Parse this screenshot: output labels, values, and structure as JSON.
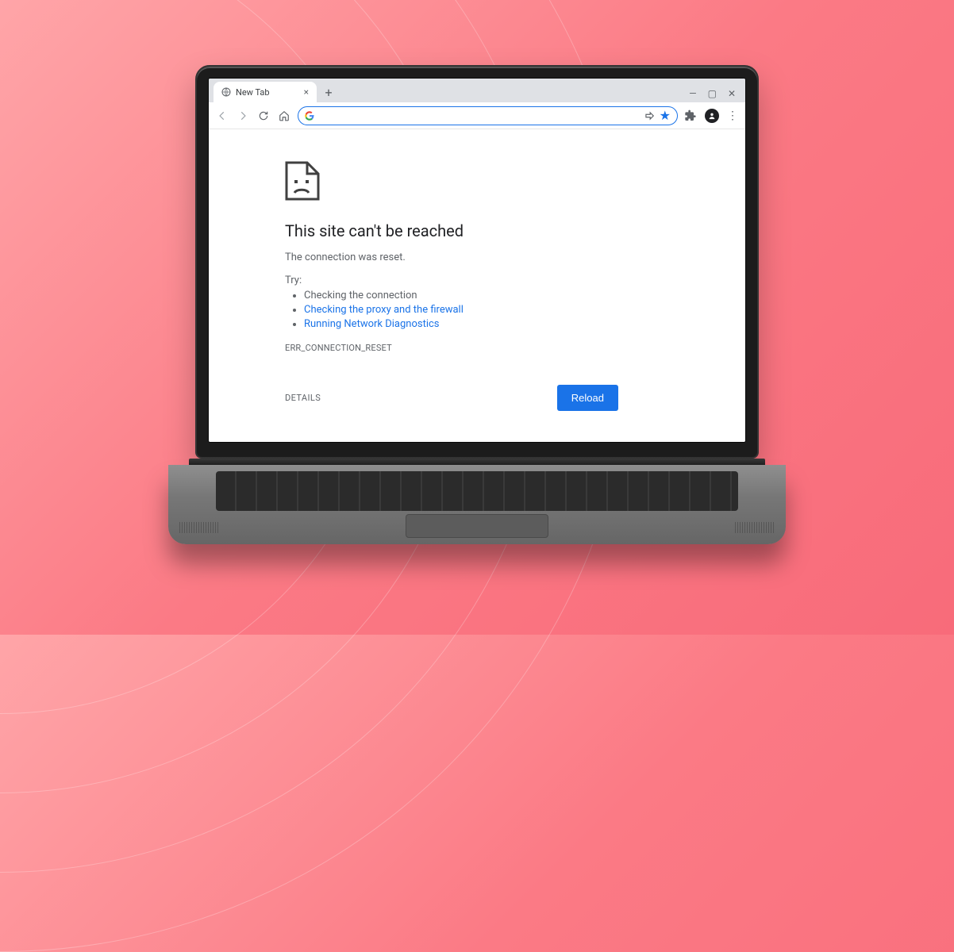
{
  "tab": {
    "title": "New Tab"
  },
  "omnibox": {
    "placeholder": ""
  },
  "error": {
    "title": "This site can't be reached",
    "subtitle": "The connection was reset.",
    "try_label": "Try:",
    "suggestions": {
      "s0": "Checking the connection",
      "s1": "Checking the proxy and the firewall",
      "s2": "Running Network Diagnostics"
    },
    "code": "ERR_CONNECTION_RESET",
    "details_label": "DETAILS",
    "reload_label": "Reload"
  }
}
